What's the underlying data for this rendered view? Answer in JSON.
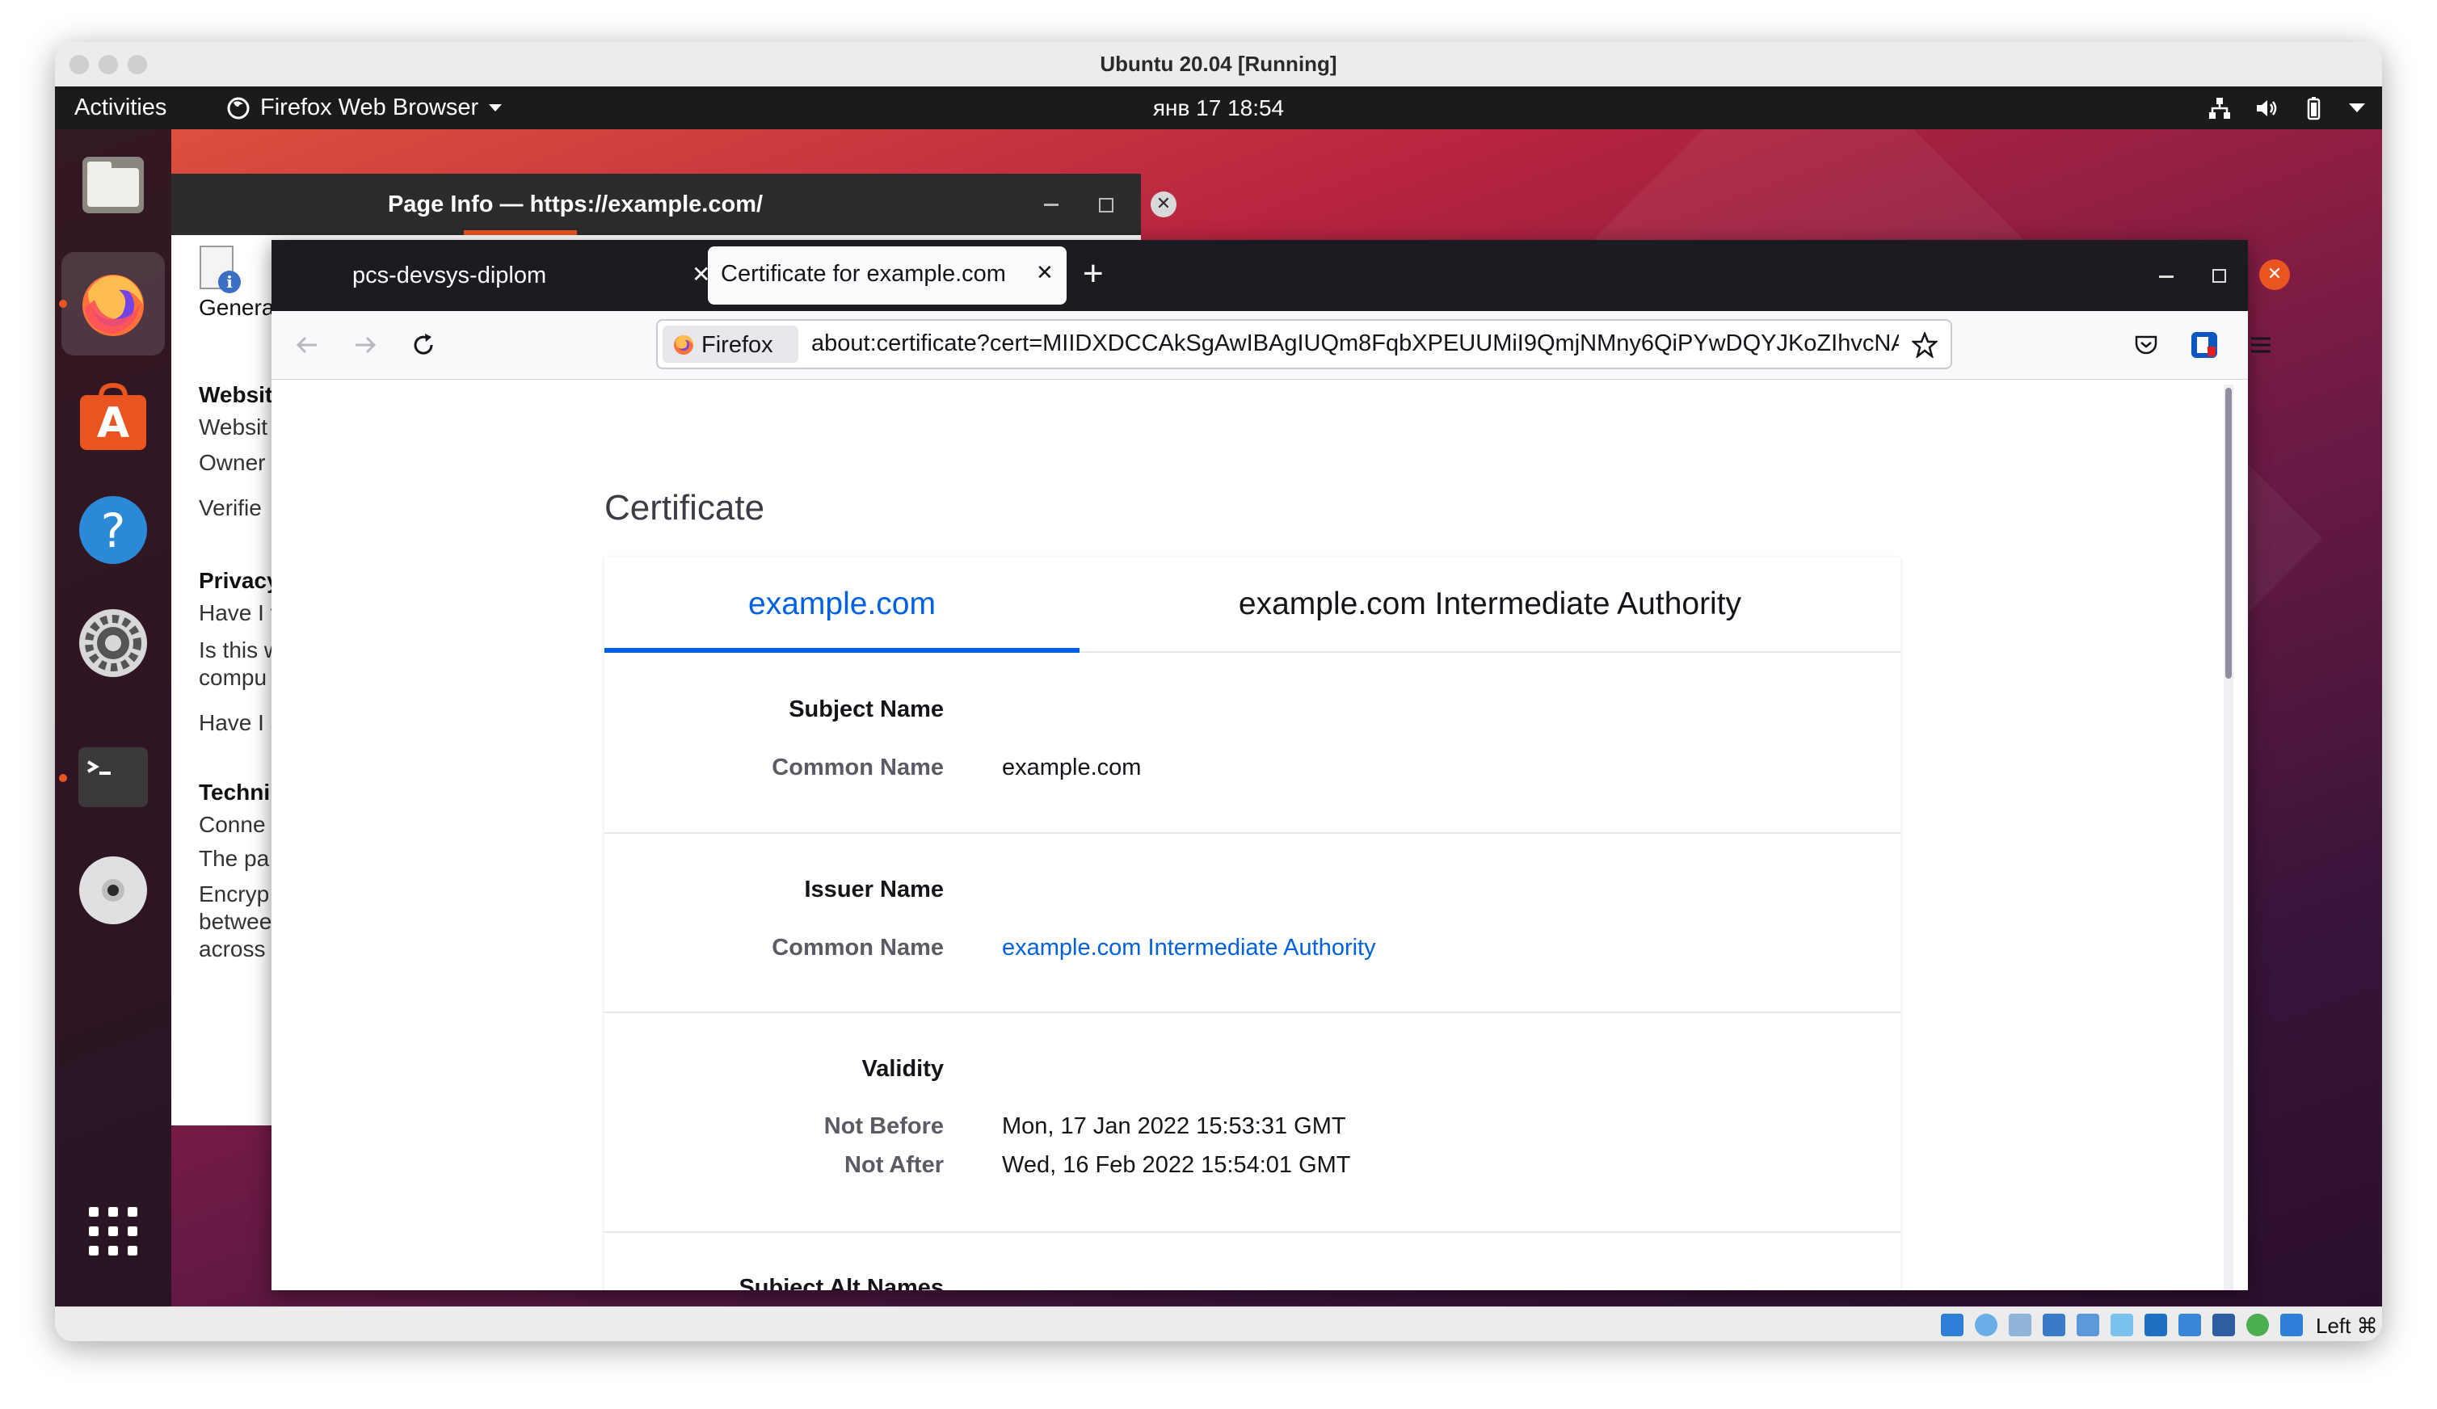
{
  "vbox": {
    "title": "Ubuntu  20.04 [Running]",
    "status_keyboard": "Left ⌘"
  },
  "topbar": {
    "activities": "Activities",
    "app_menu": "Firefox Web Browser",
    "clock": "янв 17  18:54"
  },
  "page_info": {
    "title": "Page Info — https://example.com/",
    "general_tab": "General",
    "lines": [
      "Websit",
      "Websit",
      "Owner",
      "Verifie",
      "Privacy",
      "Have I v",
      "Is this w",
      "compu",
      "Have I s",
      "Techni",
      "Conne",
      "The pa",
      "Encryp",
      "betwee",
      "across"
    ]
  },
  "firefox": {
    "tabs": [
      {
        "label": "pcs-devsys-diplom",
        "active": false
      },
      {
        "label": "Certificate for example.com",
        "active": true
      }
    ],
    "new_tab": "+",
    "identity_label": "Firefox",
    "url": "about:certificate?cert=MIIDXDCCAkSgAwIBAgIUQm8FqbXPEUUMiI9QmjNMny6QiPYwDQYJKoZIhvcNAQELBQAw"
  },
  "certificate": {
    "page_title": "Certificate",
    "tabs": [
      "example.com",
      "example.com Intermediate Authority"
    ],
    "active_tab_index": 0,
    "sections": {
      "subject": {
        "heading": "Subject Name",
        "common_name_label": "Common Name",
        "common_name_value": "example.com"
      },
      "issuer": {
        "heading": "Issuer Name",
        "common_name_label": "Common Name",
        "common_name_value": "example.com Intermediate Authority"
      },
      "validity": {
        "heading": "Validity",
        "not_before_label": "Not Before",
        "not_before_value": "Mon, 17 Jan 2022 15:53:31 GMT",
        "not_after_label": "Not After",
        "not_after_value": "Wed, 16 Feb 2022 15:54:01 GMT"
      },
      "next_heading_partial": "Subject Alt Names"
    }
  },
  "colors": {
    "accent_blue": "#0061e0",
    "tab_underline": "#0060df",
    "ubuntu_orange": "#e95420",
    "close_orange": "#e95420"
  },
  "icons": {
    "dock": [
      "files-icon",
      "firefox-icon",
      "software-center-icon",
      "help-icon",
      "settings-icon",
      "terminal-icon",
      "disc-icon",
      "app-grid-icon"
    ]
  }
}
